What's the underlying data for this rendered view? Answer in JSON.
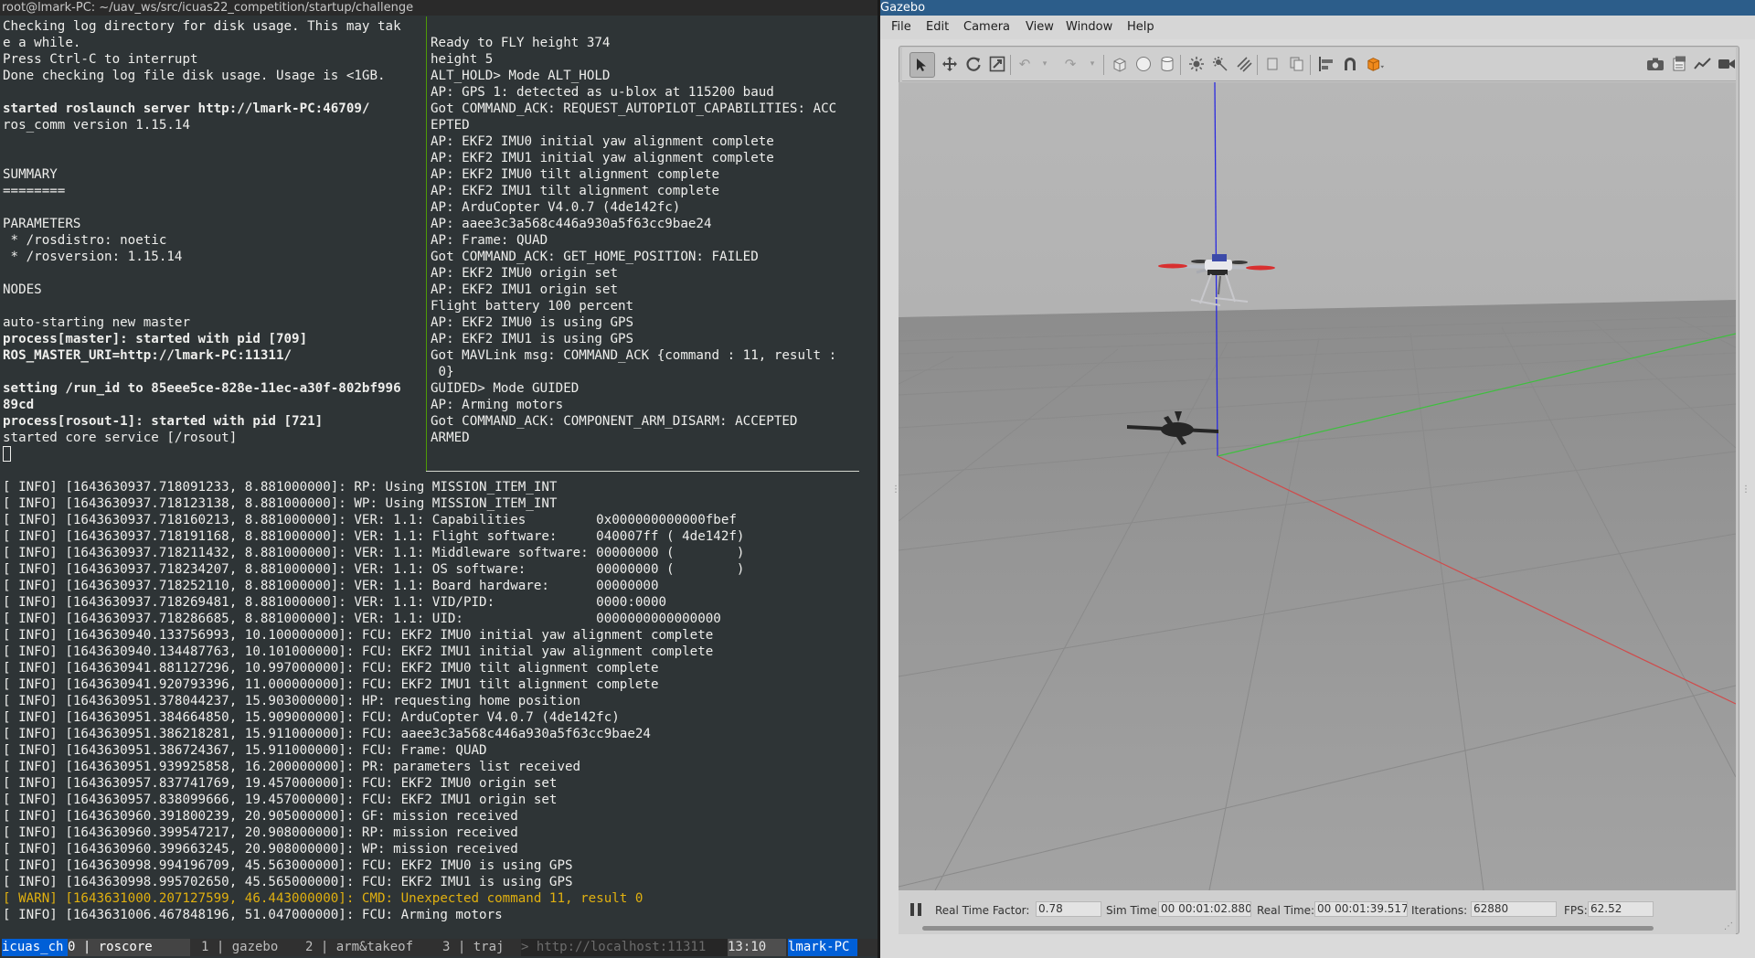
{
  "terminal": {
    "title": "root@lmark-PC: ~/uav_ws/src/icuas22_competition/startup/challenge",
    "pane_top_left": [
      {
        "t": "Checking log directory for disk usage. This may tak",
        "b": false
      },
      {
        "t": "e a while.",
        "b": false
      },
      {
        "t": "Press Ctrl-C to interrupt",
        "b": false
      },
      {
        "t": "Done checking log file disk usage. Usage is <1GB.",
        "b": false
      },
      {
        "t": "",
        "b": false
      },
      {
        "t": "started roslaunch server http://lmark-PC:46709/",
        "b": true
      },
      {
        "t": "ros_comm version 1.15.14",
        "b": false
      },
      {
        "t": "",
        "b": false
      },
      {
        "t": "",
        "b": false
      },
      {
        "t": "SUMMARY",
        "b": false
      },
      {
        "t": "========",
        "b": false
      },
      {
        "t": "",
        "b": false
      },
      {
        "t": "PARAMETERS",
        "b": false
      },
      {
        "t": " * /rosdistro: noetic",
        "b": false
      },
      {
        "t": " * /rosversion: 1.15.14",
        "b": false
      },
      {
        "t": "",
        "b": false
      },
      {
        "t": "NODES",
        "b": false
      },
      {
        "t": "",
        "b": false
      },
      {
        "t": "auto-starting new master",
        "b": false
      },
      {
        "t": "process[master]: started with pid [709]",
        "b": true
      },
      {
        "t": "ROS_MASTER_URI=http://lmark-PC:11311/",
        "b": true
      },
      {
        "t": "",
        "b": false
      },
      {
        "t": "setting /run_id to 85eee5ce-828e-11ec-a30f-802bf996",
        "b": true
      },
      {
        "t": "89cd",
        "b": true
      },
      {
        "t": "process[rosout-1]: started with pid [721]",
        "b": true
      },
      {
        "t": "started core service [/rosout]",
        "b": false
      }
    ],
    "pane_top_right": [
      "Ready to FLY height 374",
      "height 5",
      "ALT_HOLD> Mode ALT_HOLD",
      "AP: GPS 1: detected as u-blox at 115200 baud",
      "Got COMMAND_ACK: REQUEST_AUTOPILOT_CAPABILITIES: ACC",
      "EPTED",
      "AP: EKF2 IMU0 initial yaw alignment complete",
      "AP: EKF2 IMU1 initial yaw alignment complete",
      "AP: EKF2 IMU0 tilt alignment complete",
      "AP: EKF2 IMU1 tilt alignment complete",
      "AP: ArduCopter V4.0.7 (4de142fc)",
      "AP: aaee3c3a568c446a930a5f63cc9bae24",
      "AP: Frame: QUAD",
      "Got COMMAND_ACK: GET_HOME_POSITION: FAILED",
      "AP: EKF2 IMU0 origin set",
      "AP: EKF2 IMU1 origin set",
      "Flight battery 100 percent",
      "AP: EKF2 IMU0 is using GPS",
      "AP: EKF2 IMU1 is using GPS",
      "Got MAVLink msg: COMMAND_ACK {command : 11, result :",
      " 0}",
      "GUIDED> Mode GUIDED",
      "AP: Arming motors",
      "Got COMMAND_ACK: COMPONENT_ARM_DISARM: ACCEPTED",
      "ARMED"
    ],
    "pane_bottom": [
      {
        "t": "[ INFO] [1643630937.718091233, 8.881000000]: RP: Using MISSION_ITEM_INT",
        "w": false
      },
      {
        "t": "[ INFO] [1643630937.718123138, 8.881000000]: WP: Using MISSION_ITEM_INT",
        "w": false
      },
      {
        "t": "[ INFO] [1643630937.718160213, 8.881000000]: VER: 1.1: Capabilities         0x000000000000fbef",
        "w": false
      },
      {
        "t": "[ INFO] [1643630937.718191168, 8.881000000]: VER: 1.1: Flight software:     040007ff ( 4de142f)",
        "w": false
      },
      {
        "t": "[ INFO] [1643630937.718211432, 8.881000000]: VER: 1.1: Middleware software: 00000000 (        )",
        "w": false
      },
      {
        "t": "[ INFO] [1643630937.718234207, 8.881000000]: VER: 1.1: OS software:         00000000 (        )",
        "w": false
      },
      {
        "t": "[ INFO] [1643630937.718252110, 8.881000000]: VER: 1.1: Board hardware:      00000000",
        "w": false
      },
      {
        "t": "[ INFO] [1643630937.718269481, 8.881000000]: VER: 1.1: VID/PID:             0000:0000",
        "w": false
      },
      {
        "t": "[ INFO] [1643630937.718286685, 8.881000000]: VER: 1.1: UID:                 0000000000000000",
        "w": false
      },
      {
        "t": "[ INFO] [1643630940.133756993, 10.100000000]: FCU: EKF2 IMU0 initial yaw alignment complete",
        "w": false
      },
      {
        "t": "[ INFO] [1643630940.134487763, 10.101000000]: FCU: EKF2 IMU1 initial yaw alignment complete",
        "w": false
      },
      {
        "t": "[ INFO] [1643630941.881127296, 10.997000000]: FCU: EKF2 IMU0 tilt alignment complete",
        "w": false
      },
      {
        "t": "[ INFO] [1643630941.920793396, 11.000000000]: FCU: EKF2 IMU1 tilt alignment complete",
        "w": false
      },
      {
        "t": "[ INFO] [1643630951.378044237, 15.903000000]: HP: requesting home position",
        "w": false
      },
      {
        "t": "[ INFO] [1643630951.384664850, 15.909000000]: FCU: ArduCopter V4.0.7 (4de142fc)",
        "w": false
      },
      {
        "t": "[ INFO] [1643630951.386218281, 15.911000000]: FCU: aaee3c3a568c446a930a5f63cc9bae24",
        "w": false
      },
      {
        "t": "[ INFO] [1643630951.386724367, 15.911000000]: FCU: Frame: QUAD",
        "w": false
      },
      {
        "t": "[ INFO] [1643630951.939925858, 16.200000000]: PR: parameters list received",
        "w": false
      },
      {
        "t": "[ INFO] [1643630957.837741769, 19.457000000]: FCU: EKF2 IMU0 origin set",
        "w": false
      },
      {
        "t": "[ INFO] [1643630957.838099666, 19.457000000]: FCU: EKF2 IMU1 origin set",
        "w": false
      },
      {
        "t": "[ INFO] [1643630960.391800239, 20.905000000]: GF: mission received",
        "w": false
      },
      {
        "t": "[ INFO] [1643630960.399547217, 20.908000000]: RP: mission received",
        "w": false
      },
      {
        "t": "[ INFO] [1643630960.399663245, 20.908000000]: WP: mission received",
        "w": false
      },
      {
        "t": "[ INFO] [1643630998.994196709, 45.563000000]: FCU: EKF2 IMU0 is using GPS",
        "w": false
      },
      {
        "t": "[ INFO] [1643630998.995702650, 45.565000000]: FCU: EKF2 IMU1 is using GPS",
        "w": false
      },
      {
        "t": "[ WARN] [1643631000.207127599, 46.443000000]: CMD: Unexpected command 11, result 0",
        "w": true
      },
      {
        "t": "[ INFO] [1643631006.467848196, 51.047000000]: FCU: Arming motors",
        "w": false
      }
    ],
    "tmux": {
      "session": " icuas_ch ",
      "win0": " 0 | roscore ",
      "win1": " 1 | gazebo ",
      "win2": " 2 | arm&takeof ",
      "win3": " 3 | traj",
      "url": "> http://localhost:11311 ",
      "time": " 13:10 ",
      "host": " lmark-PC"
    }
  },
  "gazebo": {
    "title": "Gazebo",
    "menu": [
      "File",
      "Edit",
      "Camera",
      "View",
      "Window",
      "Help"
    ],
    "status": {
      "rtf_label": "Real Time Factor:",
      "rtf": "0.78",
      "sim_label": "Sim Time:",
      "sim": "00 00:01:02.880",
      "real_label": "Real Time:",
      "real": "00 00:01:39.517",
      "iter_label": "Iterations:",
      "iter": "62880",
      "fps_label": "FPS:",
      "fps": "62.52"
    }
  },
  "colors": {
    "terminal_bg": "#2e3436",
    "tmux_session": "#005fd7",
    "warn": "#e0b010",
    "pane_divider": "#4e9a06",
    "gazebo_title": "#2c5d8a",
    "axis_x": "#d04a4a",
    "axis_y": "#3fbf3f",
    "axis_z": "#2a2ae0"
  }
}
